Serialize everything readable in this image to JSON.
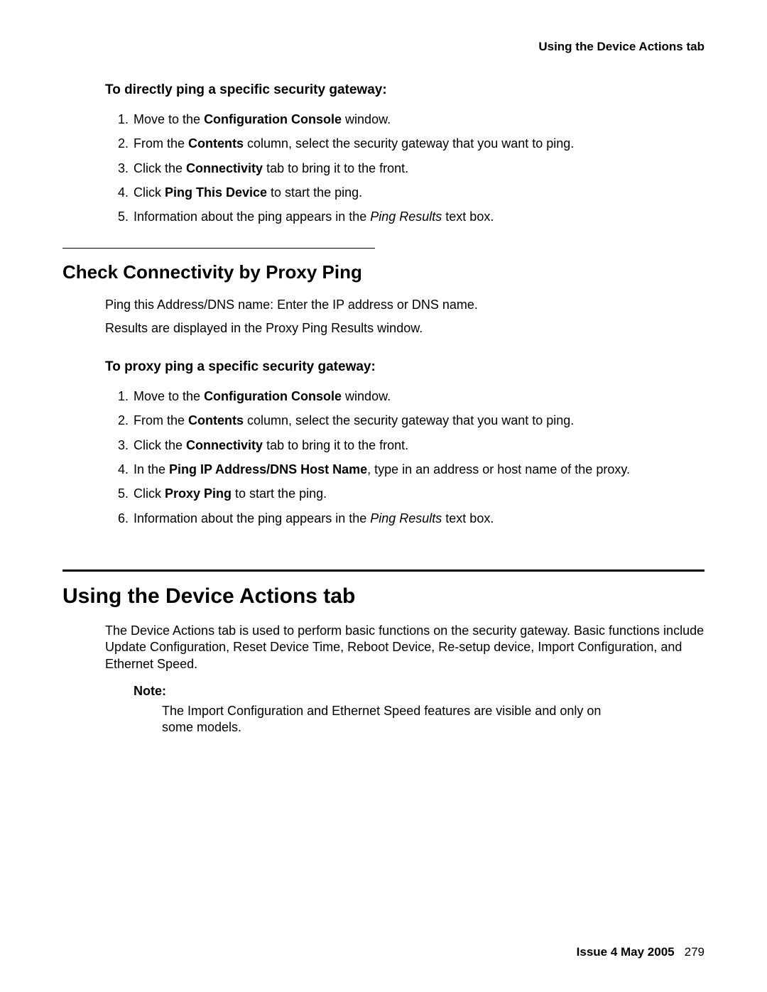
{
  "header": {
    "title": "Using the Device Actions tab"
  },
  "section1": {
    "subhead": "To directly ping a specific security gateway:",
    "steps": {
      "s1a": "Move to the ",
      "s1b": "Configuration Console",
      "s1c": " window.",
      "s2a": "From the ",
      "s2b": "Contents",
      "s2c": " column, select the security gateway that you want to ping.",
      "s3a": "Click the ",
      "s3b": "Connectivity",
      "s3c": " tab to bring it to the front.",
      "s4a": "Click ",
      "s4b": "Ping This Device",
      "s4c": " to start the ping.",
      "s5a": "Information about the ping appears in the ",
      "s5b": "Ping Results",
      "s5c": " text box."
    }
  },
  "section2": {
    "heading": "Check Connectivity by Proxy Ping",
    "p1": "Ping this Address/DNS name: Enter the IP address or DNS name.",
    "p2": "Results are displayed in the Proxy Ping Results window.",
    "subhead": "To proxy ping a specific security gateway:",
    "steps": {
      "s1a": "Move to the ",
      "s1b": "Configuration Console",
      "s1c": " window.",
      "s2a": "From the ",
      "s2b": "Contents",
      "s2c": " column, select the security gateway that you want to ping.",
      "s3a": "Click the ",
      "s3b": "Connectivity",
      "s3c": " tab to bring it to the front.",
      "s4a": "In the ",
      "s4b": "Ping IP Address/DNS Host Name",
      "s4c": ", type in an address or host name of the proxy.",
      "s5a": "Click ",
      "s5b": "Proxy Ping",
      "s5c": " to start the ping.",
      "s6a": "Information about the ping appears in the ",
      "s6b": "Ping Results",
      "s6c": " text box."
    }
  },
  "section3": {
    "heading": "Using the Device Actions tab",
    "para": "The Device Actions tab is used to perform basic functions on the security gateway. Basic functions include Update Configuration, Reset Device Time, Reboot Device, Re-setup device, Import Configuration, and Ethernet Speed.",
    "note_label": "Note:",
    "note_body": "The Import Configuration and Ethernet Speed features are visible and only on some models."
  },
  "footer": {
    "issue": "Issue 4   May 2005",
    "page": "279"
  }
}
